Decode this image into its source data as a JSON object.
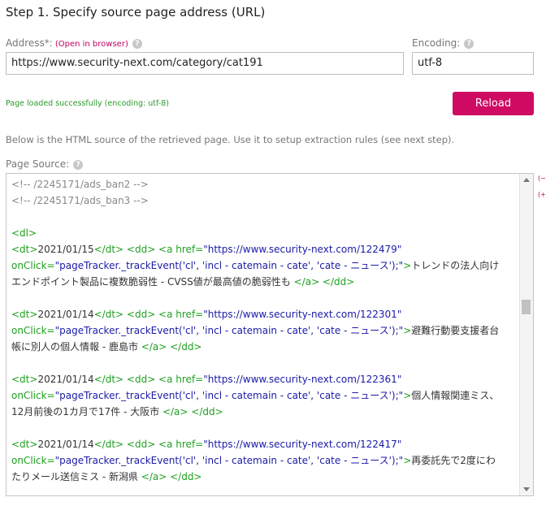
{
  "step_title": "Step 1. Specify source page address (URL)",
  "address": {
    "label": "Address*:",
    "open_link": "(Open in browser)",
    "value": "https://www.security-next.com/category/cat191"
  },
  "encoding": {
    "label": "Encoding:",
    "value": "utf-8"
  },
  "help_glyph": "?",
  "status_message": "Page loaded successfully (encoding: utf-8)",
  "reload_label": "Reload",
  "description": "Below is the HTML source of the retrieved page. Use it to setup extraction rules (see next step).",
  "source_label": "Page Source:",
  "side_links": [
    "(−",
    "(+"
  ],
  "source": {
    "comments": [
      "<!-- /2245171/ads_ban2 -->",
      "<!-- /2245171/ads_ban3 -->"
    ],
    "dl_open": "<dl>",
    "onclick_attr": "onClick=",
    "entries": [
      {
        "date": "2021/01/15",
        "href": "\"https://www.security-next.com/122479\"",
        "onclick": "\"pageTracker._trackEvent('cl', 'incl - catemain - cate', 'cate - ニュース');\"",
        "text1": "トレンドの法人向け",
        "text2": "エンドポイント製品に複数脆弱性 - CVSS値が最高値の脆弱性も"
      },
      {
        "date": "2021/01/14",
        "href": "\"https://www.security-next.com/122301\"",
        "onclick": "\"pageTracker._trackEvent('cl', 'incl - catemain - cate', 'cate - ニュース');\"",
        "text1": "避難行動要支援者台",
        "text2": "帳に別人の個人情報 - 鹿島市"
      },
      {
        "date": "2021/01/14",
        "href": "\"https://www.security-next.com/122361\"",
        "onclick": "\"pageTracker._trackEvent('cl', 'incl - catemain - cate', 'cate - ニュース');\"",
        "text1": "個人情報関連ミス、",
        "text2": "12月前後の1カ月で17件 - 大阪市"
      },
      {
        "date": "2021/01/14",
        "href": "\"https://www.security-next.com/122417\"",
        "onclick": "\"pageTracker._trackEvent('cl', 'incl - catemain - cate', 'cate - ニュース');\"",
        "text1": "再委託先で2度にわ",
        "text2": "たりメール送信ミス - 新潟県"
      }
    ]
  }
}
